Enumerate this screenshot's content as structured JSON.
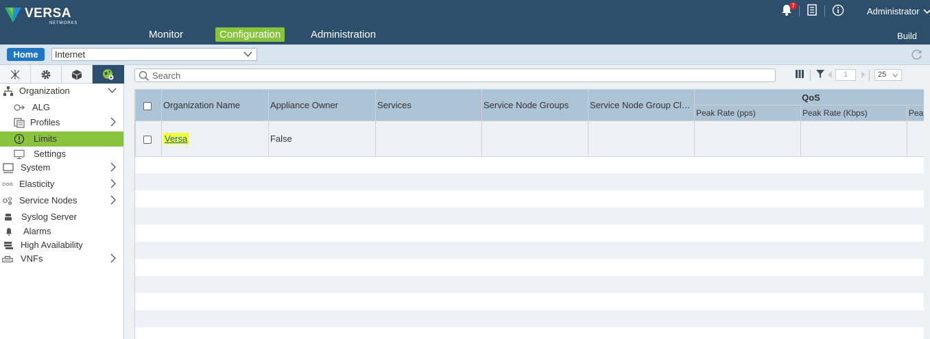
{
  "header": {
    "logo_text": "VERSA",
    "logo_sub": "NETWORKS",
    "nav": [
      {
        "label": "Monitor",
        "active": false
      },
      {
        "label": "Configuration",
        "active": true
      },
      {
        "label": "Administration",
        "active": false
      }
    ],
    "notification_count": "7",
    "user": "Administrator",
    "build_label": "Build",
    "colors": {
      "header_bg": "#2d4f6b",
      "accent": "#8ac43f"
    }
  },
  "subbar": {
    "home_label": "Home",
    "org_selected": "Internet"
  },
  "sidebar": {
    "tabs": [
      "topology-icon",
      "gear-icon",
      "cube-icon",
      "globe-gear-icon"
    ],
    "items": [
      {
        "label": "Organization",
        "icon": "org-tree-icon"
      },
      {
        "label": "ALG",
        "icon": "alg-icon"
      },
      {
        "label": "Profiles",
        "icon": "profiles-icon"
      },
      {
        "label": "Limits",
        "icon": "limits-icon"
      },
      {
        "label": "Settings",
        "icon": "settings-monitor-icon"
      },
      {
        "label": "System",
        "icon": "system-icon"
      },
      {
        "label": "Elasticity",
        "icon": "elasticity-icon"
      },
      {
        "label": "Service Nodes",
        "icon": "service-nodes-icon"
      },
      {
        "label": "Syslog Server",
        "icon": "syslog-icon"
      },
      {
        "label": "Alarms",
        "icon": "alarm-icon"
      },
      {
        "label": "High Availability",
        "icon": "ha-icon"
      },
      {
        "label": "VNFs",
        "icon": "vnf-icon"
      }
    ]
  },
  "main": {
    "search_placeholder": "Search",
    "page_number": "1",
    "page_size": "25",
    "table": {
      "columns": [
        "Organization Name",
        "Appliance Owner",
        "Services",
        "Service Node Groups",
        "Service Node Group Clus..."
      ],
      "group_header": "QoS",
      "sub_columns": [
        "Peak Rate (pps)",
        "Peak Rate (Kbps)",
        "Pea"
      ],
      "rows": [
        {
          "name": "Versa",
          "appliance_owner": "False",
          "services": "",
          "service_node_groups": "",
          "cluster": ""
        }
      ]
    }
  }
}
